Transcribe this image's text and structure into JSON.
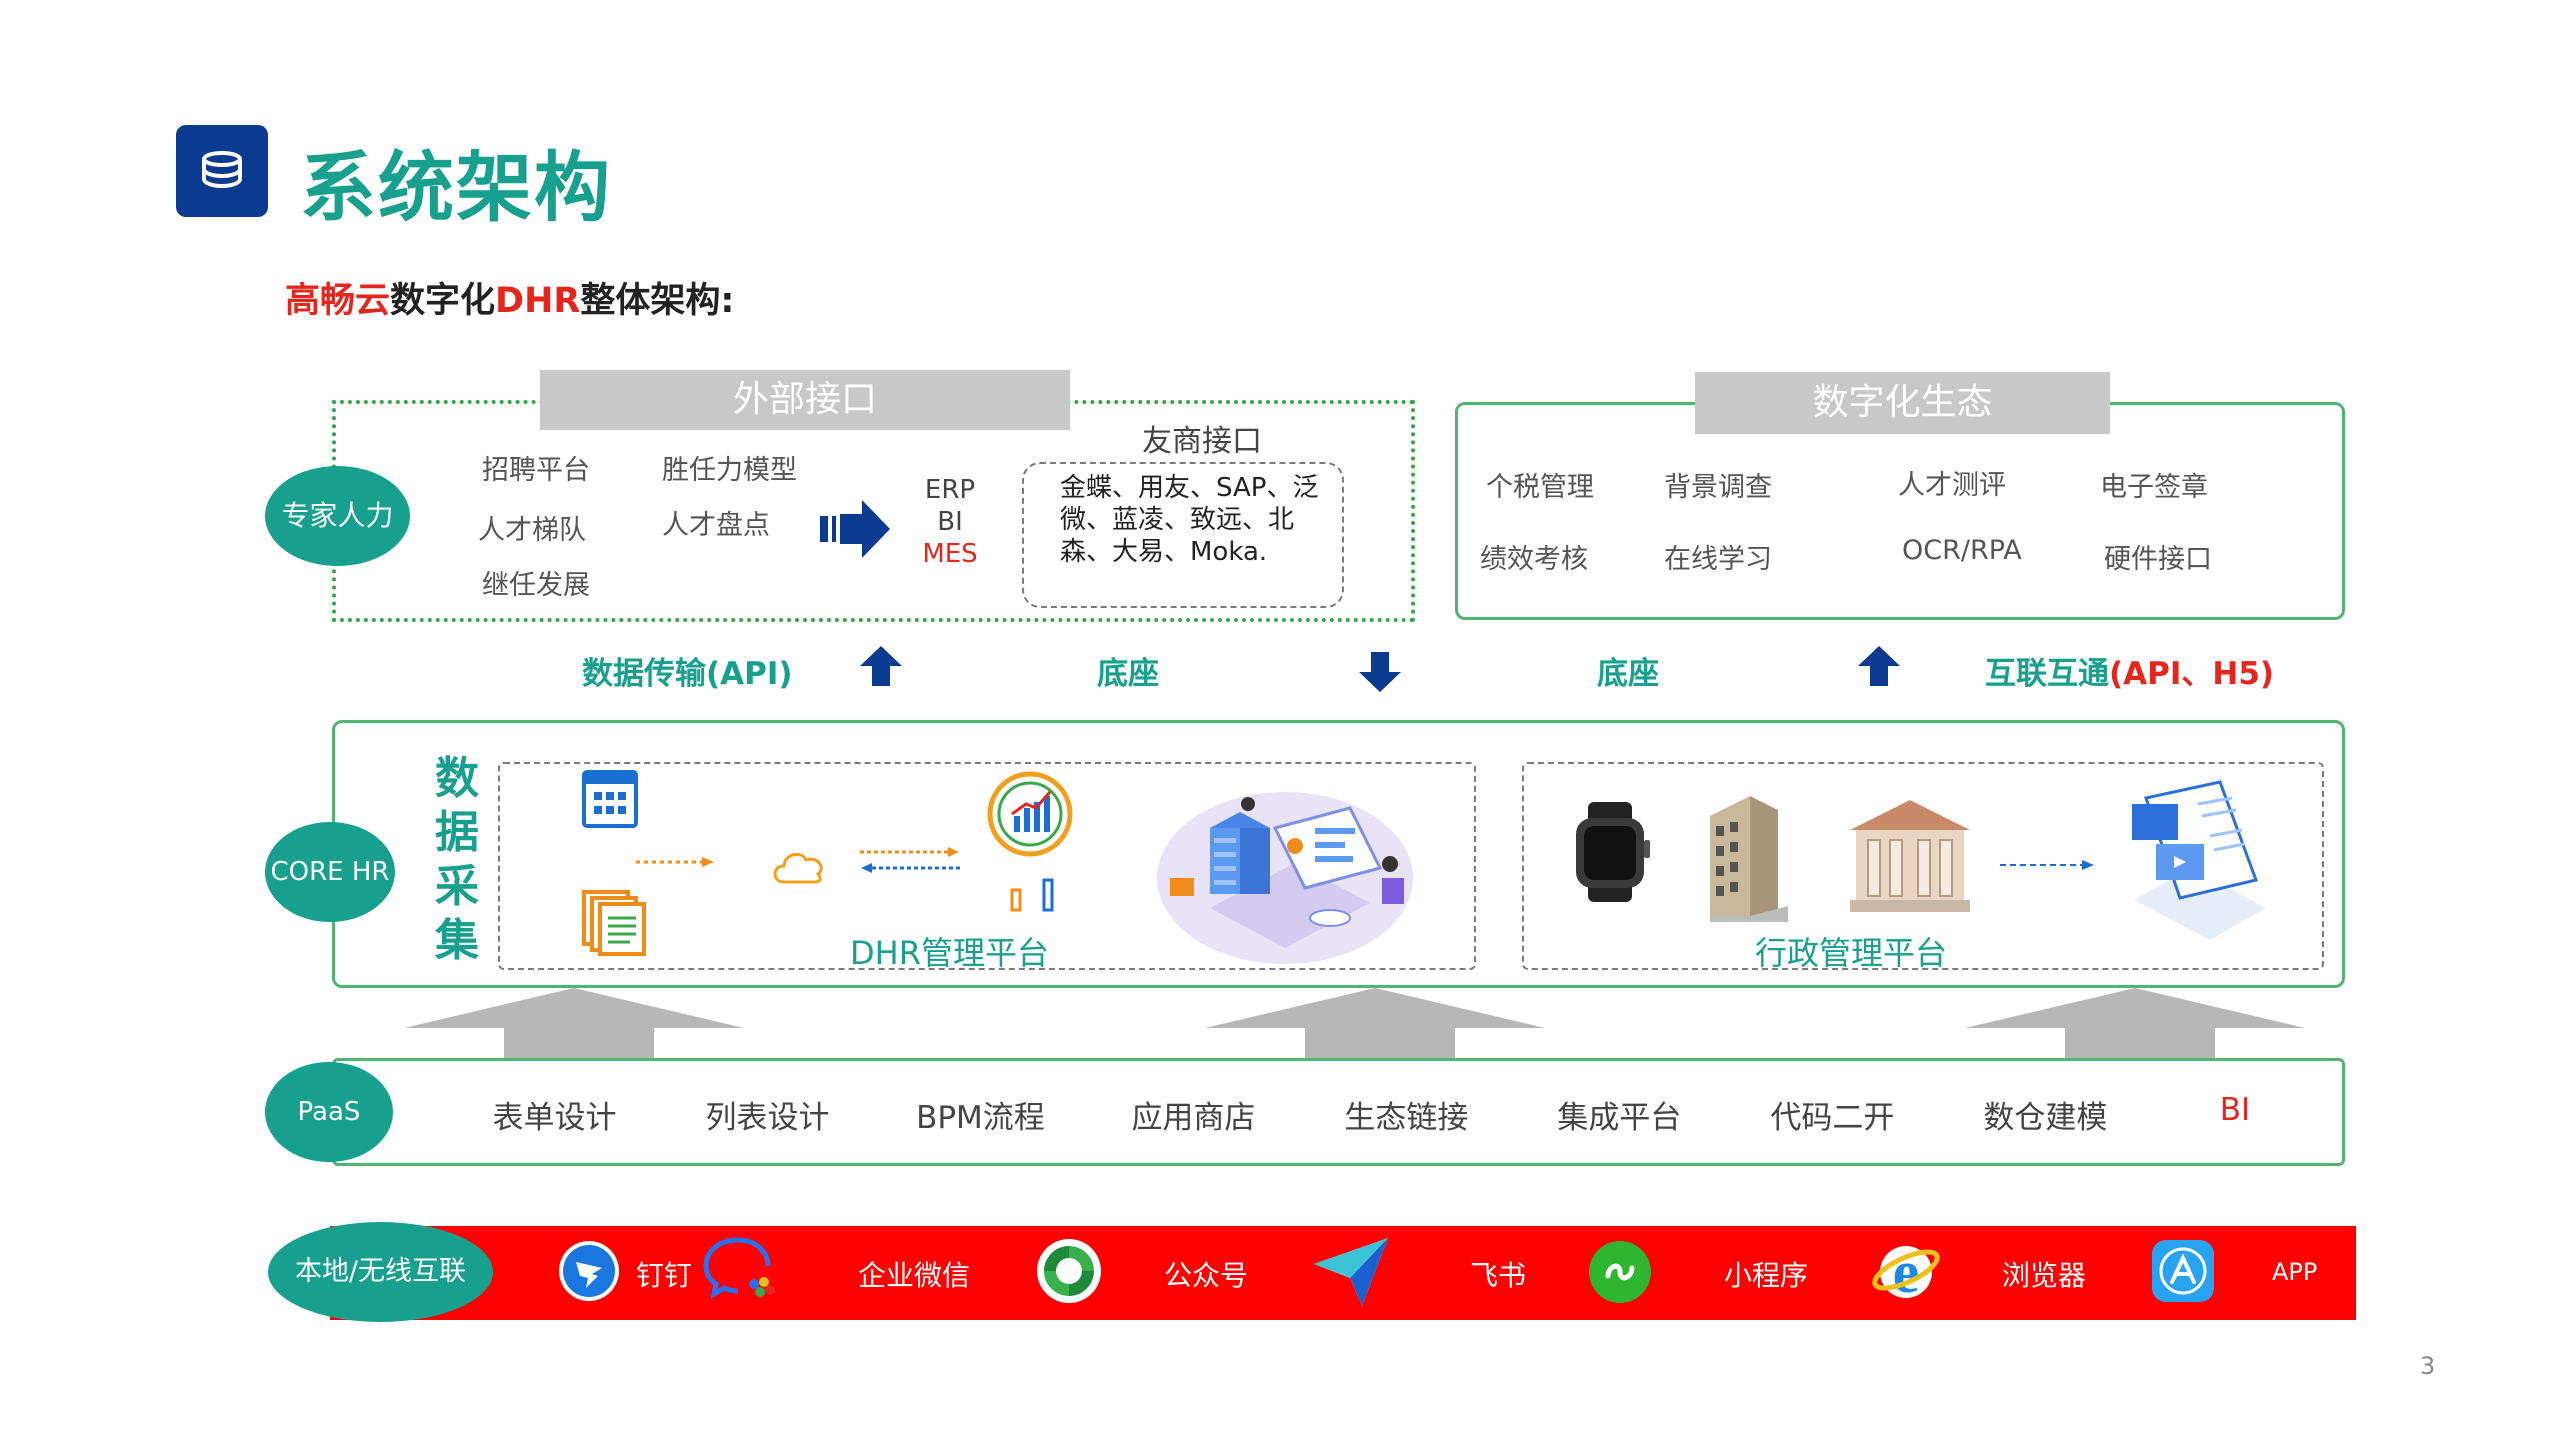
{
  "header": {
    "title": "系统架构",
    "subtitle_part1": "高畅云",
    "subtitle_part2": "数字化",
    "subtitle_part3": "DHR",
    "subtitle_part4": "整体架构:"
  },
  "external": {
    "label": "外部接口",
    "side_oval": "专家人力",
    "items": [
      "招聘平台",
      "胜任力模型",
      "人才梯队",
      "人才盘点",
      "继任发展"
    ],
    "systems": [
      "ERP",
      "BI",
      "MES"
    ],
    "partner_title": "友商接口",
    "partner_text": "金蝶、用友、SAP、泛微、蓝凌、致远、北森、大易、Moka."
  },
  "ecosystem": {
    "label": "数字化生态",
    "items": [
      "个税管理",
      "背景调查",
      "人才测评",
      "电子签章",
      "绩效考核",
      "在线学习",
      "OCR/RPA",
      "硬件接口"
    ]
  },
  "connectors": {
    "api": "数据传输(API)",
    "base1": "底座",
    "base2": "底座",
    "interop_part1": "互联互通",
    "interop_part2": "(API、H5)"
  },
  "core": {
    "oval": "CORE HR",
    "vertical_chars": [
      "数",
      "据",
      "采",
      "集"
    ],
    "dhr_label": "DHR管理平台",
    "admin_label": "行政管理平台"
  },
  "paas": {
    "oval": "PaaS",
    "items": [
      "表单设计",
      "列表设计",
      "BPM流程",
      "应用商店",
      "生态链接",
      "集成平台",
      "代码二开",
      "数仓建模",
      "BI"
    ]
  },
  "channels": {
    "oval": "本地/无线互联",
    "items": [
      "钉钉",
      "企业微信",
      "公众号",
      "飞书",
      "小程序",
      "浏览器",
      "APP"
    ]
  },
  "page_number": "3",
  "colors": {
    "teal": "#16a08d",
    "navy": "#0b3b91",
    "red": "#e4261c",
    "green_border": "#52b472",
    "ribbon": "#ff0000"
  }
}
